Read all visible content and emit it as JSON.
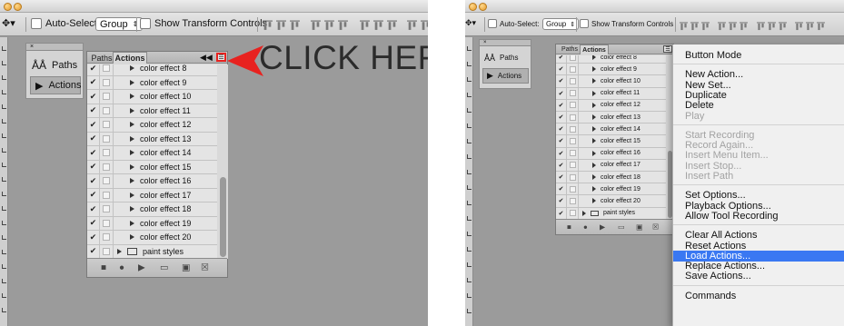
{
  "left": {
    "options_bar": {
      "auto_select_label": "Auto-Select:",
      "auto_select_value": "Group",
      "show_transform_label": "Show Transform Controls"
    },
    "dock": {
      "items": [
        "Paths",
        "Actions"
      ]
    },
    "panel": {
      "tabs": [
        "Paths",
        "Actions"
      ],
      "rows": [
        {
          "name": "color effect 8",
          "checked": true
        },
        {
          "name": "color effect 9",
          "checked": true
        },
        {
          "name": "color effect 10",
          "checked": true
        },
        {
          "name": "color effect 11",
          "checked": true
        },
        {
          "name": "color effect 12",
          "checked": true
        },
        {
          "name": "color effect 13",
          "checked": true
        },
        {
          "name": "color effect 14",
          "checked": true
        },
        {
          "name": "color effect 15",
          "checked": true
        },
        {
          "name": "color effect 16",
          "checked": true
        },
        {
          "name": "color effect 17",
          "checked": true
        },
        {
          "name": "color effect 18",
          "checked": true
        },
        {
          "name": "color effect 19",
          "checked": true
        },
        {
          "name": "color effect 20",
          "checked": true
        },
        {
          "name": "paint styles",
          "checked": true,
          "folder": true
        }
      ],
      "footer_icons": [
        "stop-icon",
        "record-icon",
        "play-icon",
        "folder-icon",
        "new-action-icon",
        "trash-icon"
      ]
    },
    "callout": {
      "text": "CLICK HERE",
      "arrow_color": "#e8221f"
    }
  },
  "right": {
    "options_bar": {
      "auto_select_label": "Auto-Select:",
      "auto_select_value": "Group",
      "show_transform_label": "Show Transform Controls"
    },
    "dock": {
      "items": [
        "Paths",
        "Actions"
      ]
    },
    "panel": {
      "tabs": [
        "Paths",
        "Actions"
      ],
      "rows": [
        {
          "name": "color effect 8",
          "checked": true
        },
        {
          "name": "color effect 9",
          "checked": true
        },
        {
          "name": "color effect 10",
          "checked": true
        },
        {
          "name": "color effect 11",
          "checked": true
        },
        {
          "name": "color effect 12",
          "checked": true
        },
        {
          "name": "color effect 13",
          "checked": true
        },
        {
          "name": "color effect 14",
          "checked": true
        },
        {
          "name": "color effect 15",
          "checked": true
        },
        {
          "name": "color effect 16",
          "checked": true
        },
        {
          "name": "color effect 17",
          "checked": true
        },
        {
          "name": "color effect 18",
          "checked": true
        },
        {
          "name": "color effect 19",
          "checked": true
        },
        {
          "name": "color effect 20",
          "checked": true
        },
        {
          "name": "paint styles",
          "checked": true,
          "folder": true
        }
      ],
      "footer_icons": [
        "stop-icon",
        "record-icon",
        "play-icon",
        "folder-icon",
        "new-action-icon",
        "trash-icon"
      ]
    },
    "menu": {
      "groups": [
        [
          {
            "label": "Button Mode",
            "enabled": true
          }
        ],
        [
          {
            "label": "New Action...",
            "enabled": true
          },
          {
            "label": "New Set...",
            "enabled": true
          },
          {
            "label": "Duplicate",
            "enabled": true
          },
          {
            "label": "Delete",
            "enabled": true
          },
          {
            "label": "Play",
            "enabled": false
          }
        ],
        [
          {
            "label": "Start Recording",
            "enabled": false
          },
          {
            "label": "Record Again...",
            "enabled": false
          },
          {
            "label": "Insert Menu Item...",
            "enabled": false
          },
          {
            "label": "Insert Stop...",
            "enabled": false
          },
          {
            "label": "Insert Path",
            "enabled": false
          }
        ],
        [
          {
            "label": "Set Options...",
            "enabled": true
          },
          {
            "label": "Playback Options...",
            "enabled": true
          },
          {
            "label": "Allow Tool Recording",
            "enabled": true
          }
        ],
        [
          {
            "label": "Clear All Actions",
            "enabled": true
          },
          {
            "label": "Reset Actions",
            "enabled": true
          },
          {
            "label": "Load Actions...",
            "enabled": true,
            "highlighted": true
          },
          {
            "label": "Replace Actions...",
            "enabled": true
          },
          {
            "label": "Save Actions...",
            "enabled": true
          }
        ],
        [
          {
            "label": "Commands",
            "enabled": true
          }
        ]
      ],
      "highlight_color": "#3a78f2"
    }
  }
}
